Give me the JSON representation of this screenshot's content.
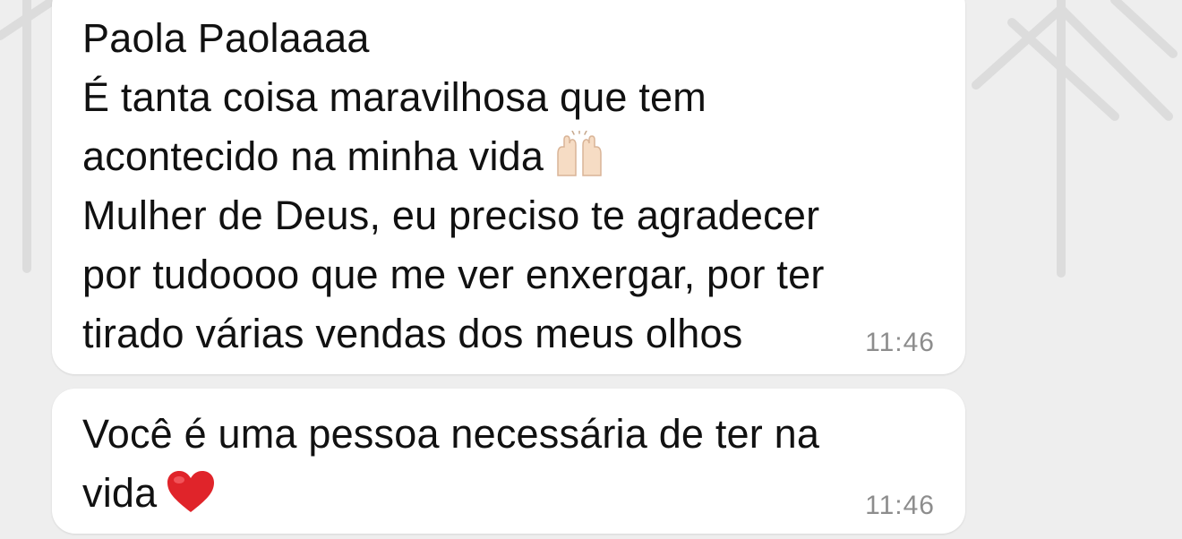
{
  "messages": [
    {
      "lines": [
        "Paola Paolaaaa",
        "É tanta coisa maravilhosa que tem",
        "acontecido na minha vida",
        "Mulher de Deus, eu preciso te agradecer",
        "por tudoooo que me ver enxergar, por ter",
        "tirado várias vendas dos meus olhos"
      ],
      "emoji": "raising-hands",
      "time": "11:46"
    },
    {
      "lines": [
        "Você é uma pessoa necessária de ter na",
        "vida"
      ],
      "emoji": "red-heart",
      "time": "11:46"
    }
  ],
  "colors": {
    "background": "#eeeeee",
    "bubble": "#ffffff",
    "text": "#111111",
    "timestamp": "#8d8d8d",
    "heart": "#e0242a"
  }
}
